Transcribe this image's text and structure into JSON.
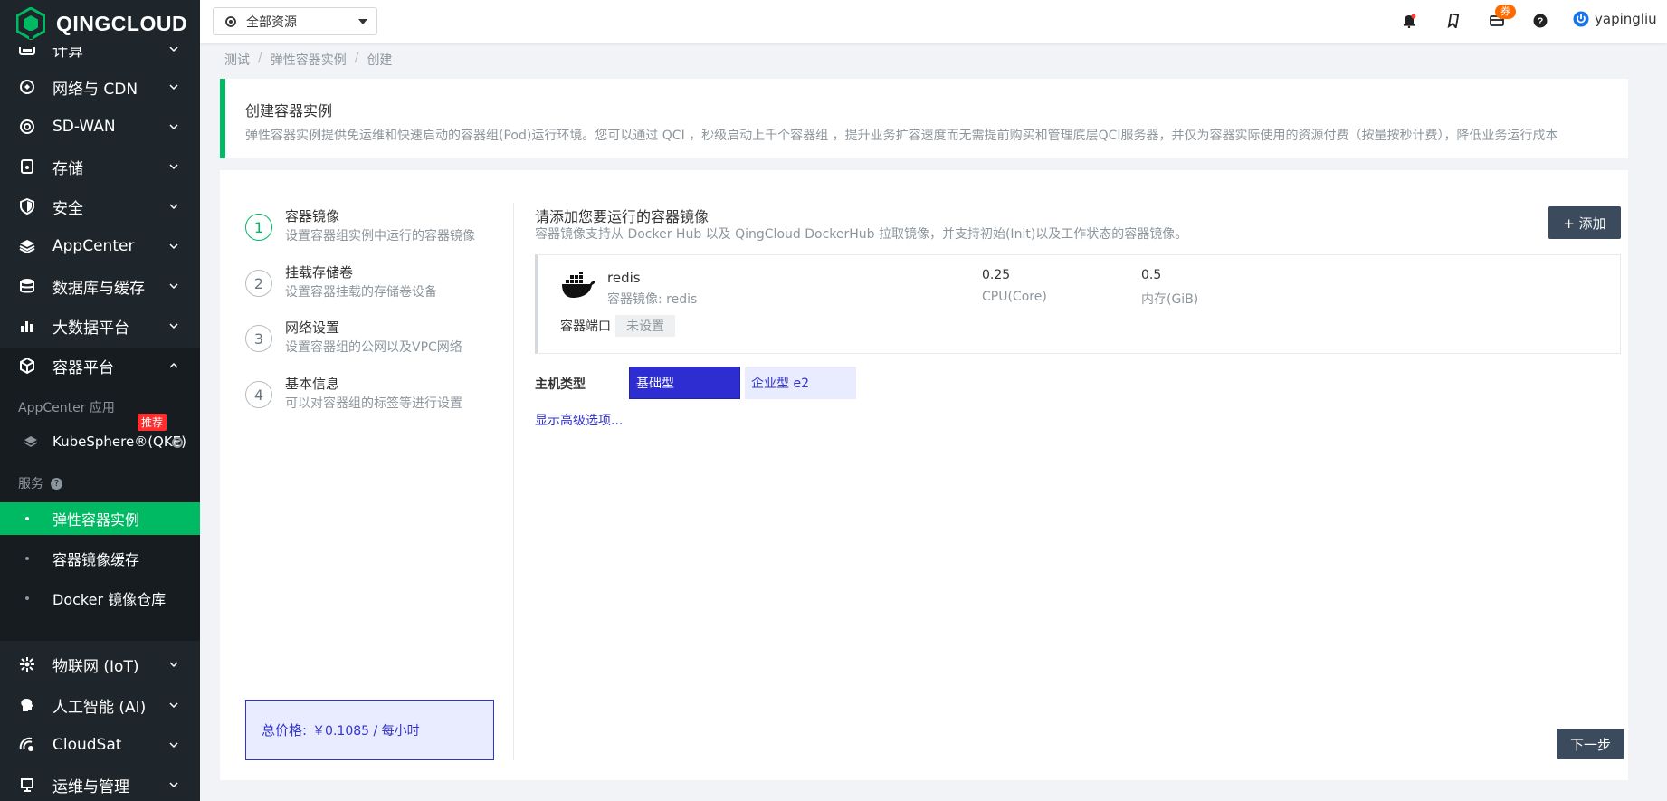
{
  "sidebar": {
    "logo_text": "QINGCLOUD",
    "nav_top": [
      {
        "label": "计算",
        "icon": "server-icon"
      },
      {
        "label": "网络与 CDN",
        "icon": "network-icon"
      },
      {
        "label": "SD-WAN",
        "icon": "sdwan-icon"
      },
      {
        "label": "存储",
        "icon": "storage-icon"
      },
      {
        "label": "安全",
        "icon": "shield-icon"
      },
      {
        "label": "AppCenter",
        "icon": "layers-icon"
      },
      {
        "label": "数据库与缓存",
        "icon": "database-icon"
      },
      {
        "label": "大数据平台",
        "icon": "bar-chart-icon"
      },
      {
        "label": "容器平台",
        "icon": "cube-icon"
      }
    ],
    "appcenter_section_label": "AppCenter 应用",
    "kubesphere_label": "KubeSphere®(QKE)",
    "recommend_badge": "推荐",
    "service_section_label": "服务",
    "services": [
      "弹性容器实例",
      "容器镜像缓存",
      "Docker 镜像仓库"
    ],
    "nav_bottom": [
      {
        "label": "物联网 (IoT)",
        "icon": "iot-icon"
      },
      {
        "label": "人工智能 (AI)",
        "icon": "ai-icon"
      },
      {
        "label": "CloudSat",
        "icon": "satellite-icon"
      },
      {
        "label": "运维与管理",
        "icon": "ops-icon"
      }
    ]
  },
  "topbar": {
    "resource_select": "全部资源",
    "coupon_badge": "券",
    "username": "yapingliu"
  },
  "breadcrumb": [
    "测试",
    "弹性容器实例",
    "创建"
  ],
  "banner": {
    "title": "创建容器实例",
    "desc": "弹性容器实例提供免运维和快速启动的容器组(Pod)运行环境。您可以通过 QCI ，秒级启动上千个容器组 ，提升业务扩容速度而无需提前购买和管理底层QCI服务器，并仅为容器实际使用的资源付费（按量按秒计费），降低业务运行成本"
  },
  "steps": [
    {
      "num": "1",
      "title": "容器镜像",
      "desc": "设置容器组实例中运行的容器镜像"
    },
    {
      "num": "2",
      "title": "挂载存储卷",
      "desc": "设置容器挂载的存储卷设备"
    },
    {
      "num": "3",
      "title": "网络设置",
      "desc": "设置容器组的公网以及VPC网络"
    },
    {
      "num": "4",
      "title": "基本信息",
      "desc": "可以对容器组的标签等进行设置"
    }
  ],
  "price": {
    "label": "总价格:",
    "value": "￥0.1085 / 每小时"
  },
  "section": {
    "title": "请添加您要运行的容器镜像",
    "desc": "容器镜像支持从 Docker Hub 以及 QingCloud DockerHub 拉取镜像，并支持初始(Init)以及工作状态的容器镜像。",
    "add_button": "+ 添加"
  },
  "image_card": {
    "name": "redis",
    "image_label": "容器镜像: redis",
    "cpu_value": "0.25",
    "cpu_label": "CPU(Core)",
    "mem_value": "0.5",
    "mem_label": "内存(GiB)",
    "port_label": "容器端口",
    "port_value": "未设置"
  },
  "host_type": {
    "label": "主机类型",
    "options": [
      "基础型",
      "企业型 e2"
    ],
    "selected": "基础型"
  },
  "advanced_link": "显示高级选项...",
  "next_button": "下一步",
  "colors": {
    "accent_green": "#00b963",
    "sidebar_bg": "#1e262b",
    "primary_blue": "#3333cc",
    "button_dark": "#3b4a5c"
  }
}
